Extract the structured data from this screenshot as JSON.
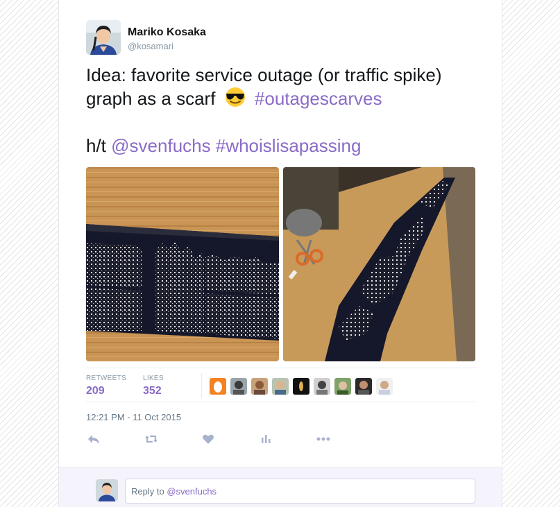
{
  "tweet": {
    "author_name": "Mariko Kosaka",
    "author_handle": "@kosamari",
    "line1": "Idea: favorite service outage (or traffic spike)",
    "line2_text": "graph as a scarf",
    "line2_hashtag": "#outagescarves",
    "line3_prefix": "h/t",
    "line3_mention": "@svenfuchs",
    "line3_hashtag": "#whoislisapassing",
    "link_color": "#8a6bc6",
    "media": [
      {
        "icon": "knitted-scarf-flat-photo"
      },
      {
        "icon": "knitted-scarf-long-photo"
      }
    ]
  },
  "stats": {
    "retweets_label": "RETWEETS",
    "retweets_count": "209",
    "likes_label": "LIKES",
    "likes_count": "352",
    "liker_avatars": [
      "orange-egg",
      "person",
      "person",
      "person",
      "dark",
      "person",
      "person",
      "person",
      "person"
    ]
  },
  "timestamp": "12:21 PM - 11 Oct 2015",
  "actions": [
    "reply-icon",
    "retweet-icon",
    "like-icon",
    "analytics-icon",
    "more-icon"
  ],
  "reply": {
    "prefix": "Reply to",
    "mention": "@svenfuchs"
  }
}
